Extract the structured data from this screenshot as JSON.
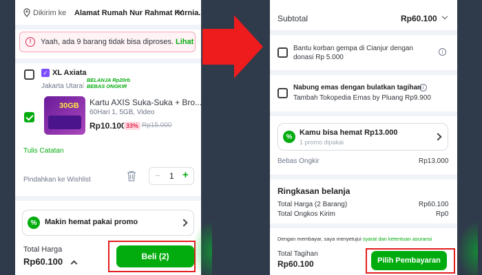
{
  "left": {
    "address_prefix": "Dikirim ke",
    "address_name": "Alamat Rumah Nur Rahmat Kurnia...",
    "warning_text": "Yaah, ada 9 barang tidak bisa diproses.",
    "warning_link": "Lihat",
    "shop_name": "XL Axiata",
    "shop_location": "Jakarta Utara",
    "shop_promo_line1": "BELANJA Rp20rb",
    "shop_promo_line2": "BEBAS ONGKIR",
    "product_thumb_text": "30GB",
    "product_name": "Kartu AXIS Suka-Suka + Bro...",
    "product_variant": "60Hari 1, 5GB, Video",
    "product_price": "Rp10.100",
    "product_discount": "33%",
    "product_original_price": "Rp15.000",
    "notes_link": "Tulis Catatan",
    "wishlist_link": "Pindahkan ke Wishlist",
    "quantity": "1",
    "qty_minus": "−",
    "qty_plus": "+",
    "promo_text": "Makin hemat pakai promo",
    "total_label": "Total Harga",
    "total_value": "Rp60.100",
    "buy_button": "Beli (2)"
  },
  "right": {
    "subtotal_label": "Subtotal",
    "subtotal_value": "Rp60.100",
    "donation_text_line1": "Bantu korban gempa di Cianjur dengan",
    "donation_text_line2": "donasi Rp 5.000",
    "gold_title": "Nabung emas dengan bulatkan tagihan",
    "gold_subtitle": "Tambah Tokopedia Emas by Pluang Rp9.900",
    "savings_title": "Kamu bisa hemat Rp13.000",
    "savings_subtitle": "1 promo dipakai",
    "free_shipping_label": "Bebas Ongkir",
    "free_shipping_value": "Rp13.000",
    "summary_title": "Ringkasan belanja",
    "total_price_label": "Total Harga (2 Barang)",
    "total_price_value": "Rp60.100",
    "total_shipping_label": "Total Ongkos Kirim",
    "total_shipping_value": "Rp0",
    "agreement_prefix": "Dengan membayar, saya menyetujui",
    "agreement_link": "syarat dan ketentuan asuransi",
    "bill_label": "Total Tagihan",
    "bill_value": "Rp60.100",
    "pay_button": "Pilih Pembayaran"
  },
  "colors": {
    "brand_green": "#03ac0e",
    "highlight_red": "#e31b1b",
    "warning_red": "#e02954",
    "background": "#2f3a4a"
  }
}
